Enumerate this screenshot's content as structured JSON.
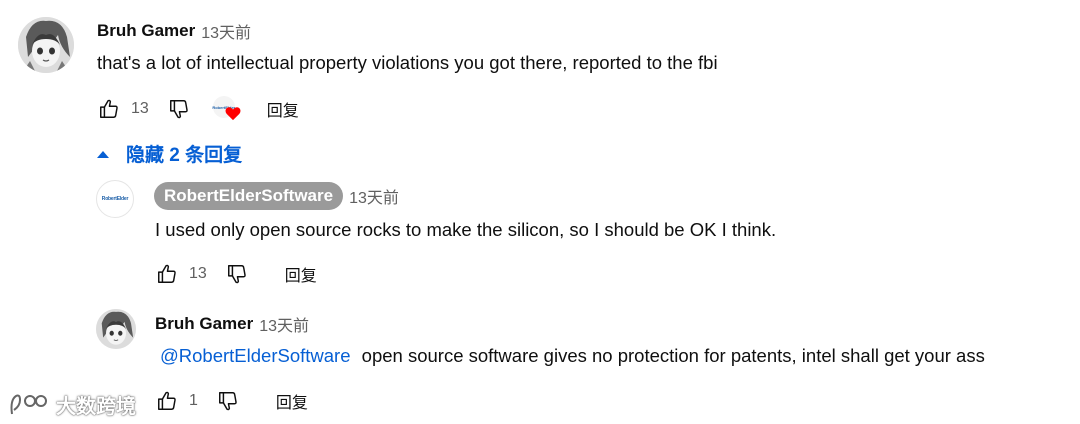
{
  "comments": [
    {
      "author": "Bruh Gamer",
      "time": "13天前",
      "text": "that's a lot of intellectual property violations you got there, reported to the fbi",
      "likes": "13",
      "reply_label": "回复",
      "creator_heart_logo": "RobertElder"
    }
  ],
  "hide_replies_label": "隐藏 2 条回复",
  "replies": [
    {
      "author": "RobertElderSoftware",
      "time": "13天前",
      "avatar_logo": "RobertElder",
      "text": "I used only open source rocks to make the silicon, so I should be OK I think.",
      "likes": "13",
      "reply_label": "回复"
    },
    {
      "author": "Bruh Gamer",
      "time": "13天前",
      "mention": "@RobertElderSoftware",
      "text": "open source software gives no protection for patents, intel shall get your ass",
      "likes": "1",
      "reply_label": "回复"
    }
  ],
  "watermark": "大数跨境",
  "colors": {
    "link": "#065fd4",
    "secondary": "#606060",
    "owner_badge": "#9a9a9a",
    "heart": "#ff0000"
  }
}
